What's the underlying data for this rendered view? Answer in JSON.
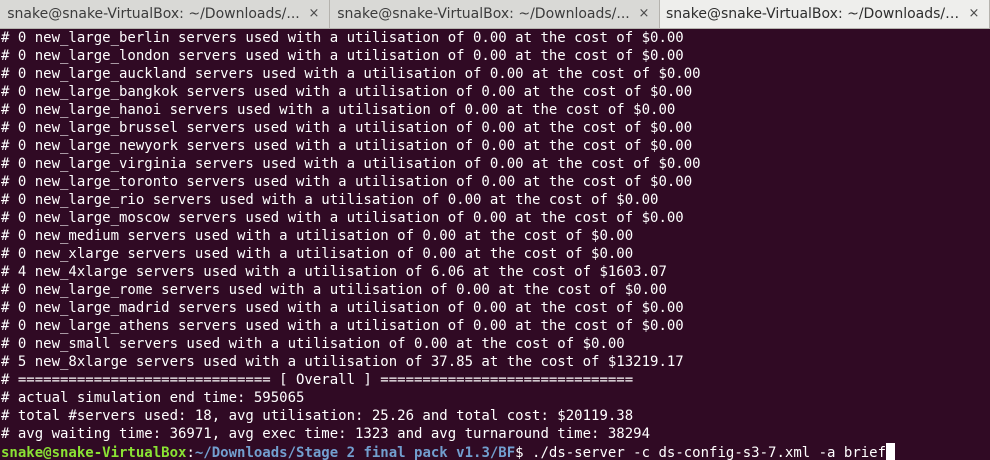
{
  "tabs": [
    {
      "title": "snake@snake-VirtualBox: ~/Downloads/...",
      "close": "×",
      "active": false
    },
    {
      "title": "snake@snake-VirtualBox: ~/Downloads/...",
      "close": "×",
      "active": false
    },
    {
      "title": "snake@snake-VirtualBox: ~/Downloads/S...",
      "close": "×",
      "active": true
    }
  ],
  "terminal": {
    "lines": [
      "# 0 new_large_berlin servers used with a utilisation of 0.00 at the cost of $0.00",
      "# 0 new_large_london servers used with a utilisation of 0.00 at the cost of $0.00",
      "# 0 new_large_auckland servers used with a utilisation of 0.00 at the cost of $0.00",
      "# 0 new_large_bangkok servers used with a utilisation of 0.00 at the cost of $0.00",
      "# 0 new_large_hanoi servers used with a utilisation of 0.00 at the cost of $0.00",
      "# 0 new_large_brussel servers used with a utilisation of 0.00 at the cost of $0.00",
      "# 0 new_large_newyork servers used with a utilisation of 0.00 at the cost of $0.00",
      "# 0 new_large_virginia servers used with a utilisation of 0.00 at the cost of $0.00",
      "# 0 new_large_toronto servers used with a utilisation of 0.00 at the cost of $0.00",
      "# 0 new_large_rio servers used with a utilisation of 0.00 at the cost of $0.00",
      "# 0 new_large_moscow servers used with a utilisation of 0.00 at the cost of $0.00",
      "# 0 new_medium servers used with a utilisation of 0.00 at the cost of $0.00",
      "# 0 new_xlarge servers used with a utilisation of 0.00 at the cost of $0.00",
      "# 4 new_4xlarge servers used with a utilisation of 6.06 at the cost of $1603.07",
      "# 0 new_large_rome servers used with a utilisation of 0.00 at the cost of $0.00",
      "# 0 new_large_madrid servers used with a utilisation of 0.00 at the cost of $0.00",
      "# 0 new_large_athens servers used with a utilisation of 0.00 at the cost of $0.00",
      "# 0 new_small servers used with a utilisation of 0.00 at the cost of $0.00",
      "# 5 new_8xlarge servers used with a utilisation of 37.85 at the cost of $13219.17",
      "# ============================== [ Overall ] ==============================",
      "# actual simulation end time: 595065",
      "# total #servers used: 18, avg utilisation: 25.26 and total cost: $20119.38",
      "# avg waiting time: 36971, avg exec time: 1323 and avg turnaround time: 38294"
    ],
    "prompt": {
      "user_host": "snake@snake-VirtualBox",
      "colon": ":",
      "path": "~/Downloads/Stage 2 final pack v1.3/BF",
      "sign": "$ ",
      "command": "./ds-server -c ds-config-s3-7.xml -a brief"
    }
  },
  "colors": {
    "background": "#300a24",
    "prompt_user": "#8ae234",
    "prompt_path": "#729fcf",
    "text": "#ffffff",
    "tabbar": "#d9d9d6",
    "active_tab": "#eeeeec"
  }
}
